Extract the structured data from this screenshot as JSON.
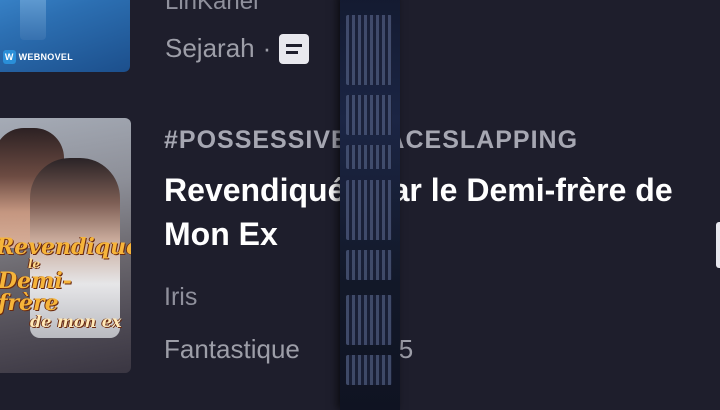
{
  "items": [
    {
      "author": "LinKanei",
      "genre": "Sejarah",
      "separator": "·",
      "cover_badge": "WEBNOVEL",
      "icon": "document-icon"
    },
    {
      "tags": "#POSSESSIVE #FACESLAPPING",
      "title": "Revendiquée par le Demi-frère de Mon Ex",
      "author": "Iris",
      "genre": "Fantastique",
      "count": "275",
      "cover_text": {
        "line1": "Revendiquée",
        "line2": "le",
        "line3": "Demi-frère",
        "line4": "de mon ex"
      }
    }
  ],
  "colors": {
    "background": "#1e1e2c",
    "title": "#ffffff",
    "secondary": "#9d9ea8",
    "cover_title": "#f6b43a"
  }
}
